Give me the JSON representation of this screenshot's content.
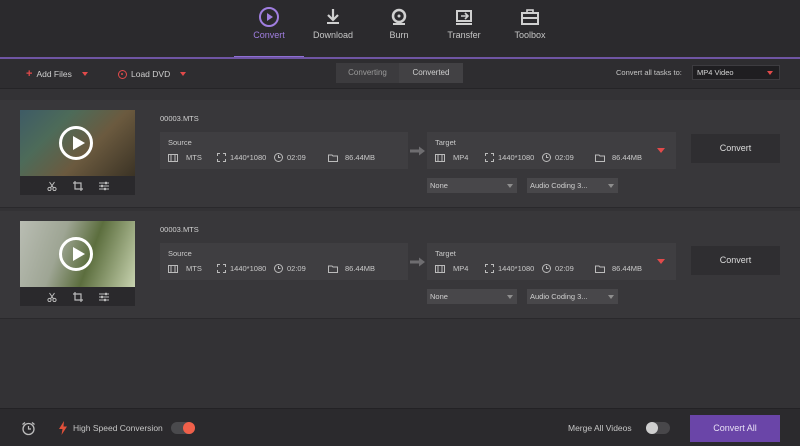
{
  "nav": {
    "items": [
      {
        "label": "Convert",
        "icon": "convert-play-icon",
        "active": true
      },
      {
        "label": "Download",
        "icon": "download-icon",
        "active": false
      },
      {
        "label": "Burn",
        "icon": "burn-disc-icon",
        "active": false
      },
      {
        "label": "Transfer",
        "icon": "transfer-icon",
        "active": false
      },
      {
        "label": "Toolbox",
        "icon": "toolbox-icon",
        "active": false
      }
    ]
  },
  "toolbar": {
    "add_files": "Add Files",
    "load_dvd": "Load DVD",
    "tab_converting": "Converting",
    "tab_converted": "Converted",
    "convert_all_label": "Convert all tasks to:",
    "convert_all_value": "MP4 Video"
  },
  "items": [
    {
      "filename": "00003.MTS",
      "source": {
        "label": "Source",
        "format": "MTS",
        "resolution": "1440*1080",
        "duration": "02:09",
        "size": "86.44MB"
      },
      "target": {
        "label": "Target",
        "format": "MP4",
        "resolution": "1440*1080",
        "duration": "02:09",
        "size": "86.44MB"
      },
      "convert_label": "Convert",
      "subtitle_value": "None",
      "audio_value": "Audio Coding 3..."
    },
    {
      "filename": "00003.MTS",
      "source": {
        "label": "Source",
        "format": "MTS",
        "resolution": "1440*1080",
        "duration": "02:09",
        "size": "86.44MB"
      },
      "target": {
        "label": "Target",
        "format": "MP4",
        "resolution": "1440*1080",
        "duration": "02:09",
        "size": "86.44MB"
      },
      "convert_label": "Convert",
      "subtitle_value": "None",
      "audio_value": "Audio Coding 3..."
    }
  ],
  "bottom": {
    "high_speed_label": "High Speed Conversion",
    "high_speed_on": true,
    "merge_label": "Merge All Videos",
    "merge_on": false,
    "convert_all_button": "Convert All"
  },
  "colors": {
    "accent": "#6a45a8",
    "active_nav": "#a07ee0",
    "red": "#e24a4a",
    "toggle_on": "#f0604a"
  }
}
